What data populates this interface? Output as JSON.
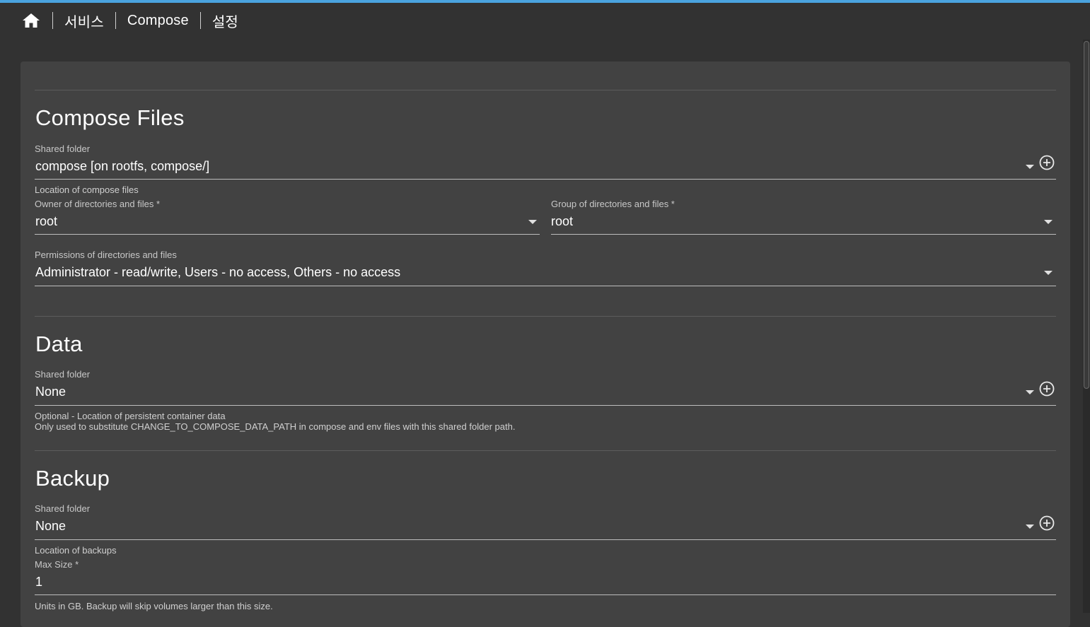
{
  "breadcrumb": {
    "home_icon": "home-icon",
    "items": [
      "서비스",
      "Compose",
      "설정"
    ]
  },
  "sections": {
    "compose_files": {
      "title": "Compose Files",
      "shared_folder_label": "Shared folder",
      "shared_folder_value": "compose [on rootfs, compose/]",
      "shared_folder_hint": "Location of compose files",
      "owner_label": "Owner of directories and files *",
      "owner_value": "root",
      "group_label": "Group of directories and files *",
      "group_value": "root",
      "permissions_label": "Permissions of directories and files",
      "permissions_value": "Administrator - read/write, Users - no access, Others - no access"
    },
    "data": {
      "title": "Data",
      "shared_folder_label": "Shared folder",
      "shared_folder_value": "None",
      "hint_line1": "Optional - Location of persistent container data",
      "hint_line2": "Only used to substitute CHANGE_TO_COMPOSE_DATA_PATH in compose and env files with this shared folder path."
    },
    "backup": {
      "title": "Backup",
      "shared_folder_label": "Shared folder",
      "shared_folder_value": "None",
      "shared_folder_hint": "Location of backups",
      "max_size_label": "Max Size *",
      "max_size_value": "1",
      "max_size_hint": "Units in GB. Backup will skip volumes larger than this size."
    }
  },
  "colors": {
    "accent": "#4aa3df",
    "page_background": "#323232",
    "card_background": "#424242"
  }
}
